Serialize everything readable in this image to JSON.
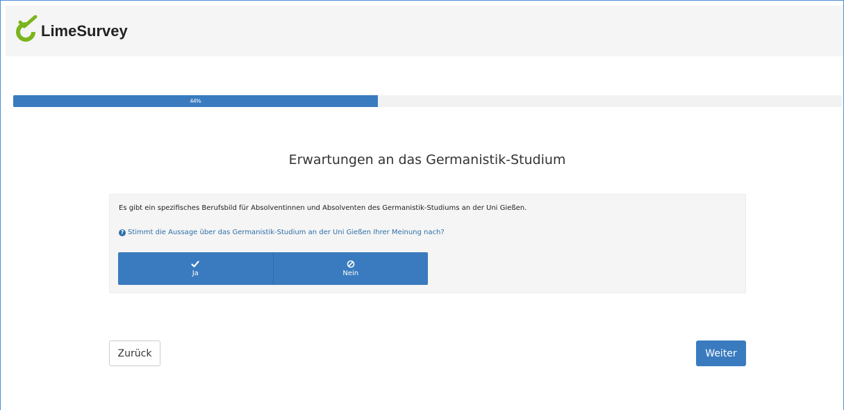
{
  "brand": {
    "name": "LimeSurvey"
  },
  "progress": {
    "label": "44%",
    "value": 0.44
  },
  "group": {
    "title": "Erwartungen an das Germanistik-Studium"
  },
  "question": {
    "text": "Es gibt ein spezifisches Berufsbild für Absolventinnen und Absolventen des Germanistik-Studiums an der Uni Gießen.",
    "help": "Stimmt die Aussage über das Germanistik-Studium an der Uni Gießen Ihrer Meinung nach?",
    "options": [
      {
        "label": "Ja",
        "icon": "check-icon"
      },
      {
        "label": "Nein",
        "icon": "ban-icon"
      }
    ]
  },
  "nav": {
    "back_label": "Zurück",
    "next_label": "Weiter"
  },
  "colors": {
    "primary": "#3a7bbf",
    "logo_green": "#7ab51d",
    "help_blue": "#2f6fa8"
  }
}
